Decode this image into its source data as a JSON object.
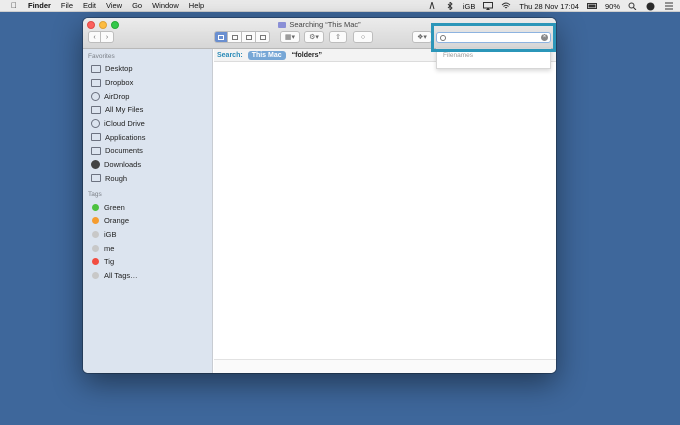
{
  "menubar": {
    "app": "Finder",
    "menus": [
      "File",
      "Edit",
      "View",
      "Go",
      "Window",
      "Help"
    ],
    "status_text": "iGB",
    "datetime": "Thu 28 Nov  17:04",
    "battery": "90%"
  },
  "window": {
    "title": "Searching “This Mac”"
  },
  "search": {
    "value": "",
    "suggestion": "Filenames"
  },
  "scopebar": {
    "label": "Search:",
    "scope": "This Mac",
    "query": "“folders”"
  },
  "sidebar": {
    "favorites_title": "Favorites",
    "favorites": [
      {
        "label": "Desktop",
        "icon": "desktop-icon"
      },
      {
        "label": "Dropbox",
        "icon": "folder-icon"
      },
      {
        "label": "AirDrop",
        "icon": "airdrop-icon"
      },
      {
        "label": "All My Files",
        "icon": "all-files-icon"
      },
      {
        "label": "iCloud Drive",
        "icon": "cloud-icon"
      },
      {
        "label": "Applications",
        "icon": "applications-icon"
      },
      {
        "label": "Documents",
        "icon": "documents-icon"
      },
      {
        "label": "Downloads",
        "icon": "downloads-icon"
      },
      {
        "label": "Rough",
        "icon": "folder-icon"
      }
    ],
    "tags_title": "Tags",
    "tags": [
      {
        "label": "Green",
        "color": "#4cc13f"
      },
      {
        "label": "Orange",
        "color": "#f59c2f"
      },
      {
        "label": "iGB",
        "color": "#c8c8c8"
      },
      {
        "label": "me",
        "color": "#c8c8c8"
      },
      {
        "label": "Tig",
        "color": "#f24d41"
      },
      {
        "label": "All Tags…",
        "color": "#c8c8c8"
      }
    ]
  },
  "colors": {
    "desktop": "#3e679b",
    "highlight": "#2b96b9",
    "scope_label": "#2b8bb8"
  }
}
